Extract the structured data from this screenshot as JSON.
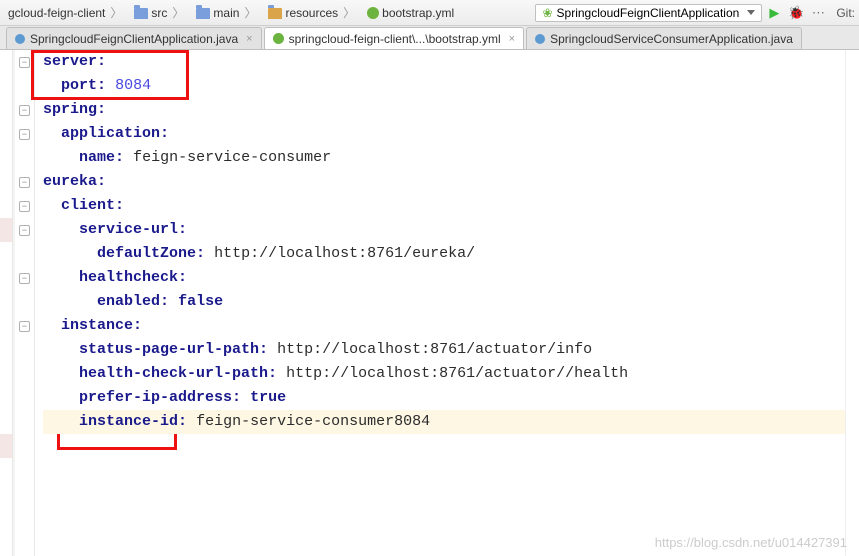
{
  "breadcrumb": {
    "project": "gcloud-feign-client",
    "src": "src",
    "main": "main",
    "resources": "resources",
    "file": "bootstrap.yml"
  },
  "runConfig": {
    "name": "SpringcloudFeignClientApplication"
  },
  "gitLabel": "Git:",
  "tabs": {
    "t0": {
      "label": "SpringcloudFeignClientApplication.java"
    },
    "t1": {
      "label": "springcloud-feign-client\\...\\bootstrap.yml"
    },
    "t2": {
      "label": "SpringcloudServiceConsumerApplication.java"
    }
  },
  "yaml": {
    "server": "server",
    "port_key": "port",
    "port_val": "8084",
    "spring": "spring",
    "application": "application",
    "name_key": "name",
    "name_val": "feign-service-consumer",
    "eureka": "eureka",
    "client": "client",
    "service_url": "service-url",
    "defaultZone_key": "defaultZone",
    "defaultZone_val": "http://localhost:8761/eureka/",
    "healthcheck": "healthcheck",
    "enabled_key": "enabled",
    "enabled_val": "false",
    "instance": "instance",
    "status_key": "status-page-url-path",
    "status_val": "http://localhost:8761/actuator/info",
    "health_key": "health-check-url-path",
    "health_val": "http://localhost:8761/actuator//health",
    "prefer_key": "prefer-ip-address",
    "prefer_val": "true",
    "instance_id_key": "instance-id",
    "instance_id_val": "feign-service-consumer8084"
  },
  "watermark": "https://blog.csdn.net/u014427391"
}
